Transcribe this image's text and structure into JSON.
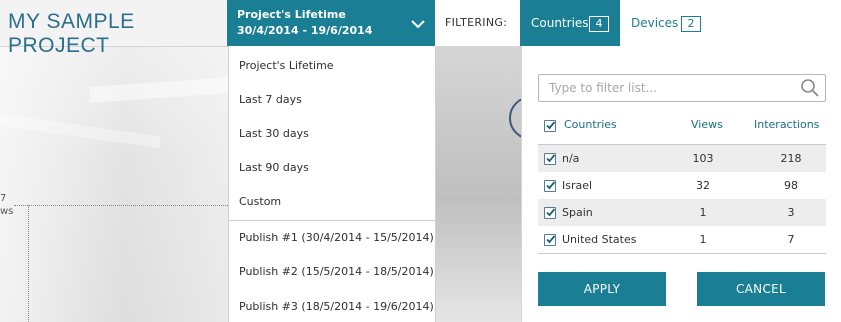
{
  "header": {
    "project_title": "MY SAMPLE PROJECT",
    "date_selector": {
      "title": "Project's Lifetime",
      "range": "30/4/2014 - 19/6/2014"
    },
    "filtering_label": "FILTERING:",
    "tabs": [
      {
        "label": "Countries",
        "count": "4",
        "active": true
      },
      {
        "label": "Devices",
        "count": "2",
        "active": false
      }
    ]
  },
  "chart_background": {
    "axis_value": "7",
    "axis_unit": "ws"
  },
  "date_dropdown": {
    "items": [
      "Project's Lifetime",
      "Last 7 days",
      "Last 30 days",
      "Last 90 days",
      "Custom"
    ],
    "publishes": [
      "Publish #1 (30/4/2014 - 15/5/2014)",
      "Publish #2 (15/5/2014 - 18/5/2014)",
      "Publish #3 (18/5/2014 - 19/6/2014)"
    ]
  },
  "filter_panel": {
    "search_placeholder": "Type to filter list...",
    "columns": {
      "name": "Countries",
      "views": "Views",
      "interactions": "Interactions"
    },
    "rows": [
      {
        "name": "n/a",
        "views": "103",
        "interactions": "218",
        "checked": true
      },
      {
        "name": "Israel",
        "views": "32",
        "interactions": "98",
        "checked": true
      },
      {
        "name": "Spain",
        "views": "1",
        "interactions": "3",
        "checked": true
      },
      {
        "name": "United States",
        "views": "1",
        "interactions": "7",
        "checked": true
      }
    ],
    "apply_label": "APPLY",
    "cancel_label": "CANCEL"
  },
  "colors": {
    "accent": "#1a7f94",
    "title": "#2b6f8a"
  }
}
